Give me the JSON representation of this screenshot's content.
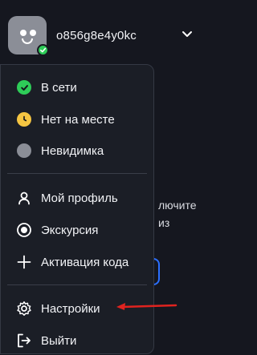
{
  "header": {
    "username": "o856g8e4y0kc",
    "status_color": "#2ecc58"
  },
  "background": {
    "line1": "лючите",
    "line2": "из"
  },
  "menu": {
    "status_items": [
      {
        "label": "В сети",
        "icon": "online-status-icon",
        "color": "#2ecc58"
      },
      {
        "label": "Нет на месте",
        "icon": "away-status-icon",
        "color": "#f5c542"
      },
      {
        "label": "Невидимка",
        "icon": "invisible-status-icon",
        "color": "#8b8e97"
      }
    ],
    "account_items": [
      {
        "label": "Мой профиль",
        "icon": "user-icon"
      },
      {
        "label": "Экскурсия",
        "icon": "tour-icon"
      },
      {
        "label": "Активация кода",
        "icon": "plus-icon"
      }
    ],
    "settings_label": "Настройки",
    "logout_label": "Выйти"
  },
  "annotation": {
    "arrow_color": "#e0231f"
  }
}
